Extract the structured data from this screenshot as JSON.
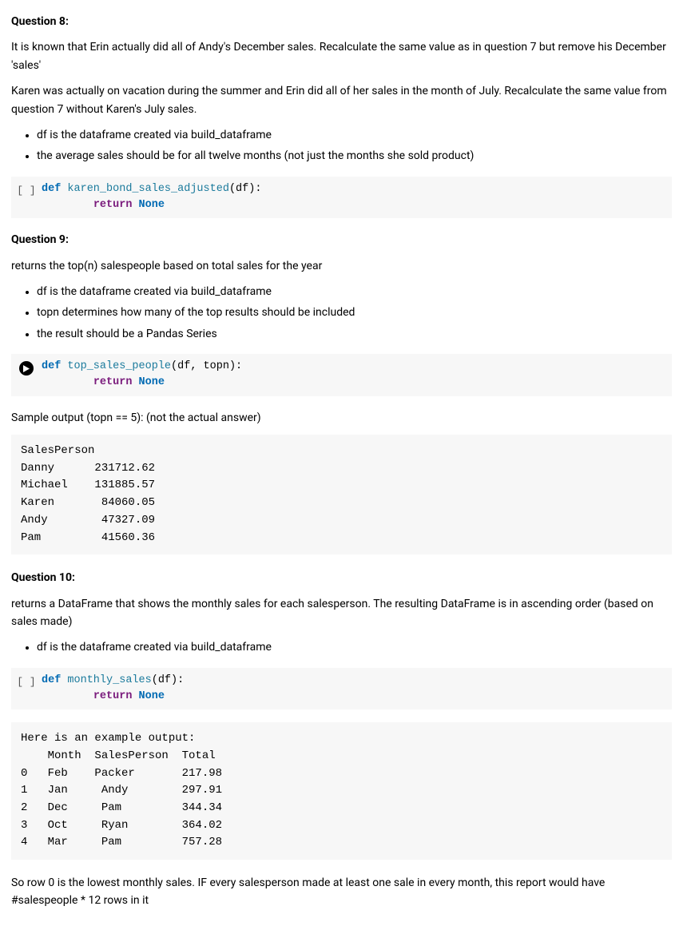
{
  "q8": {
    "title": "Question 8:",
    "p1": "It is known that Erin actually did all of Andy's December sales. Recalculate the same value as in question 7 but remove his December 'sales'",
    "p2": "Karen was actually on vacation during the summer and Erin did all of her sales in the month of July. Recalculate the same value from question 7 without Karen's July sales.",
    "b1": "df is the dataframe created via build_dataframe",
    "b2": "the average sales should be for all twelve months (not just the months she sold product)",
    "gutter": "[ ]",
    "code": {
      "def": "def ",
      "fn": "karen_bond_sales_adjusted",
      "params": "(df):",
      "indent": "        ",
      "ret": "return ",
      "none": "None"
    }
  },
  "q9": {
    "title": "Question 9:",
    "p1": "returns the top(n) salespeople based on total sales for the year",
    "b1": "df is the dataframe created via build_dataframe",
    "b2": "topn determines how many of the top results should be included",
    "b3": "the result should be a Pandas Series",
    "code": {
      "def": "def ",
      "fn": "top_sales_people",
      "params": "(df, topn):",
      "indent": "        ",
      "ret": "return ",
      "none": "None"
    },
    "sample_label": "Sample output (topn == 5): (not the actual answer)",
    "sample_output": "SalesPerson\nDanny      231712.62\nMichael    131885.57\nKaren       84060.05\nAndy        47327.09\nPam         41560.36",
    "chart_data": {
      "type": "table",
      "title": "SalesPerson",
      "categories": [
        "Danny",
        "Michael",
        "Karen",
        "Andy",
        "Pam"
      ],
      "values": [
        231712.62,
        131885.57,
        84060.05,
        47327.09,
        41560.36
      ]
    }
  },
  "q10": {
    "title": "Question 10:",
    "p1": "returns a DataFrame that shows the monthly sales for each salesperson. The resulting DataFrame is in ascending order (based on sales made)",
    "b1": "df is the dataframe created via build_dataframe",
    "gutter": "[ ]",
    "code": {
      "def": "def ",
      "fn": "monthly_sales",
      "params": "(df):",
      "indent": "        ",
      "ret": "return ",
      "none": "None"
    },
    "example_output": "Here is an example output:\n    Month  SalesPerson  Total\n0   Feb    Packer       217.98\n1   Jan     Andy        297.91\n2   Dec     Pam         344.34\n3   Oct     Ryan        364.02\n4   Mar     Pam         757.28",
    "chart_data": {
      "type": "table",
      "columns": [
        "",
        "Month",
        "SalesPerson",
        "Total"
      ],
      "rows": [
        [
          0,
          "Feb",
          "Packer",
          217.98
        ],
        [
          1,
          "Jan",
          "Andy",
          297.91
        ],
        [
          2,
          "Dec",
          "Pam",
          344.34
        ],
        [
          3,
          "Oct",
          "Ryan",
          364.02
        ],
        [
          4,
          "Mar",
          "Pam",
          757.28
        ]
      ]
    },
    "footer": "So row 0 is the lowest monthly sales. IF every salesperson made at least one sale in every month, this report would have #salespeople * 12 rows in it"
  }
}
